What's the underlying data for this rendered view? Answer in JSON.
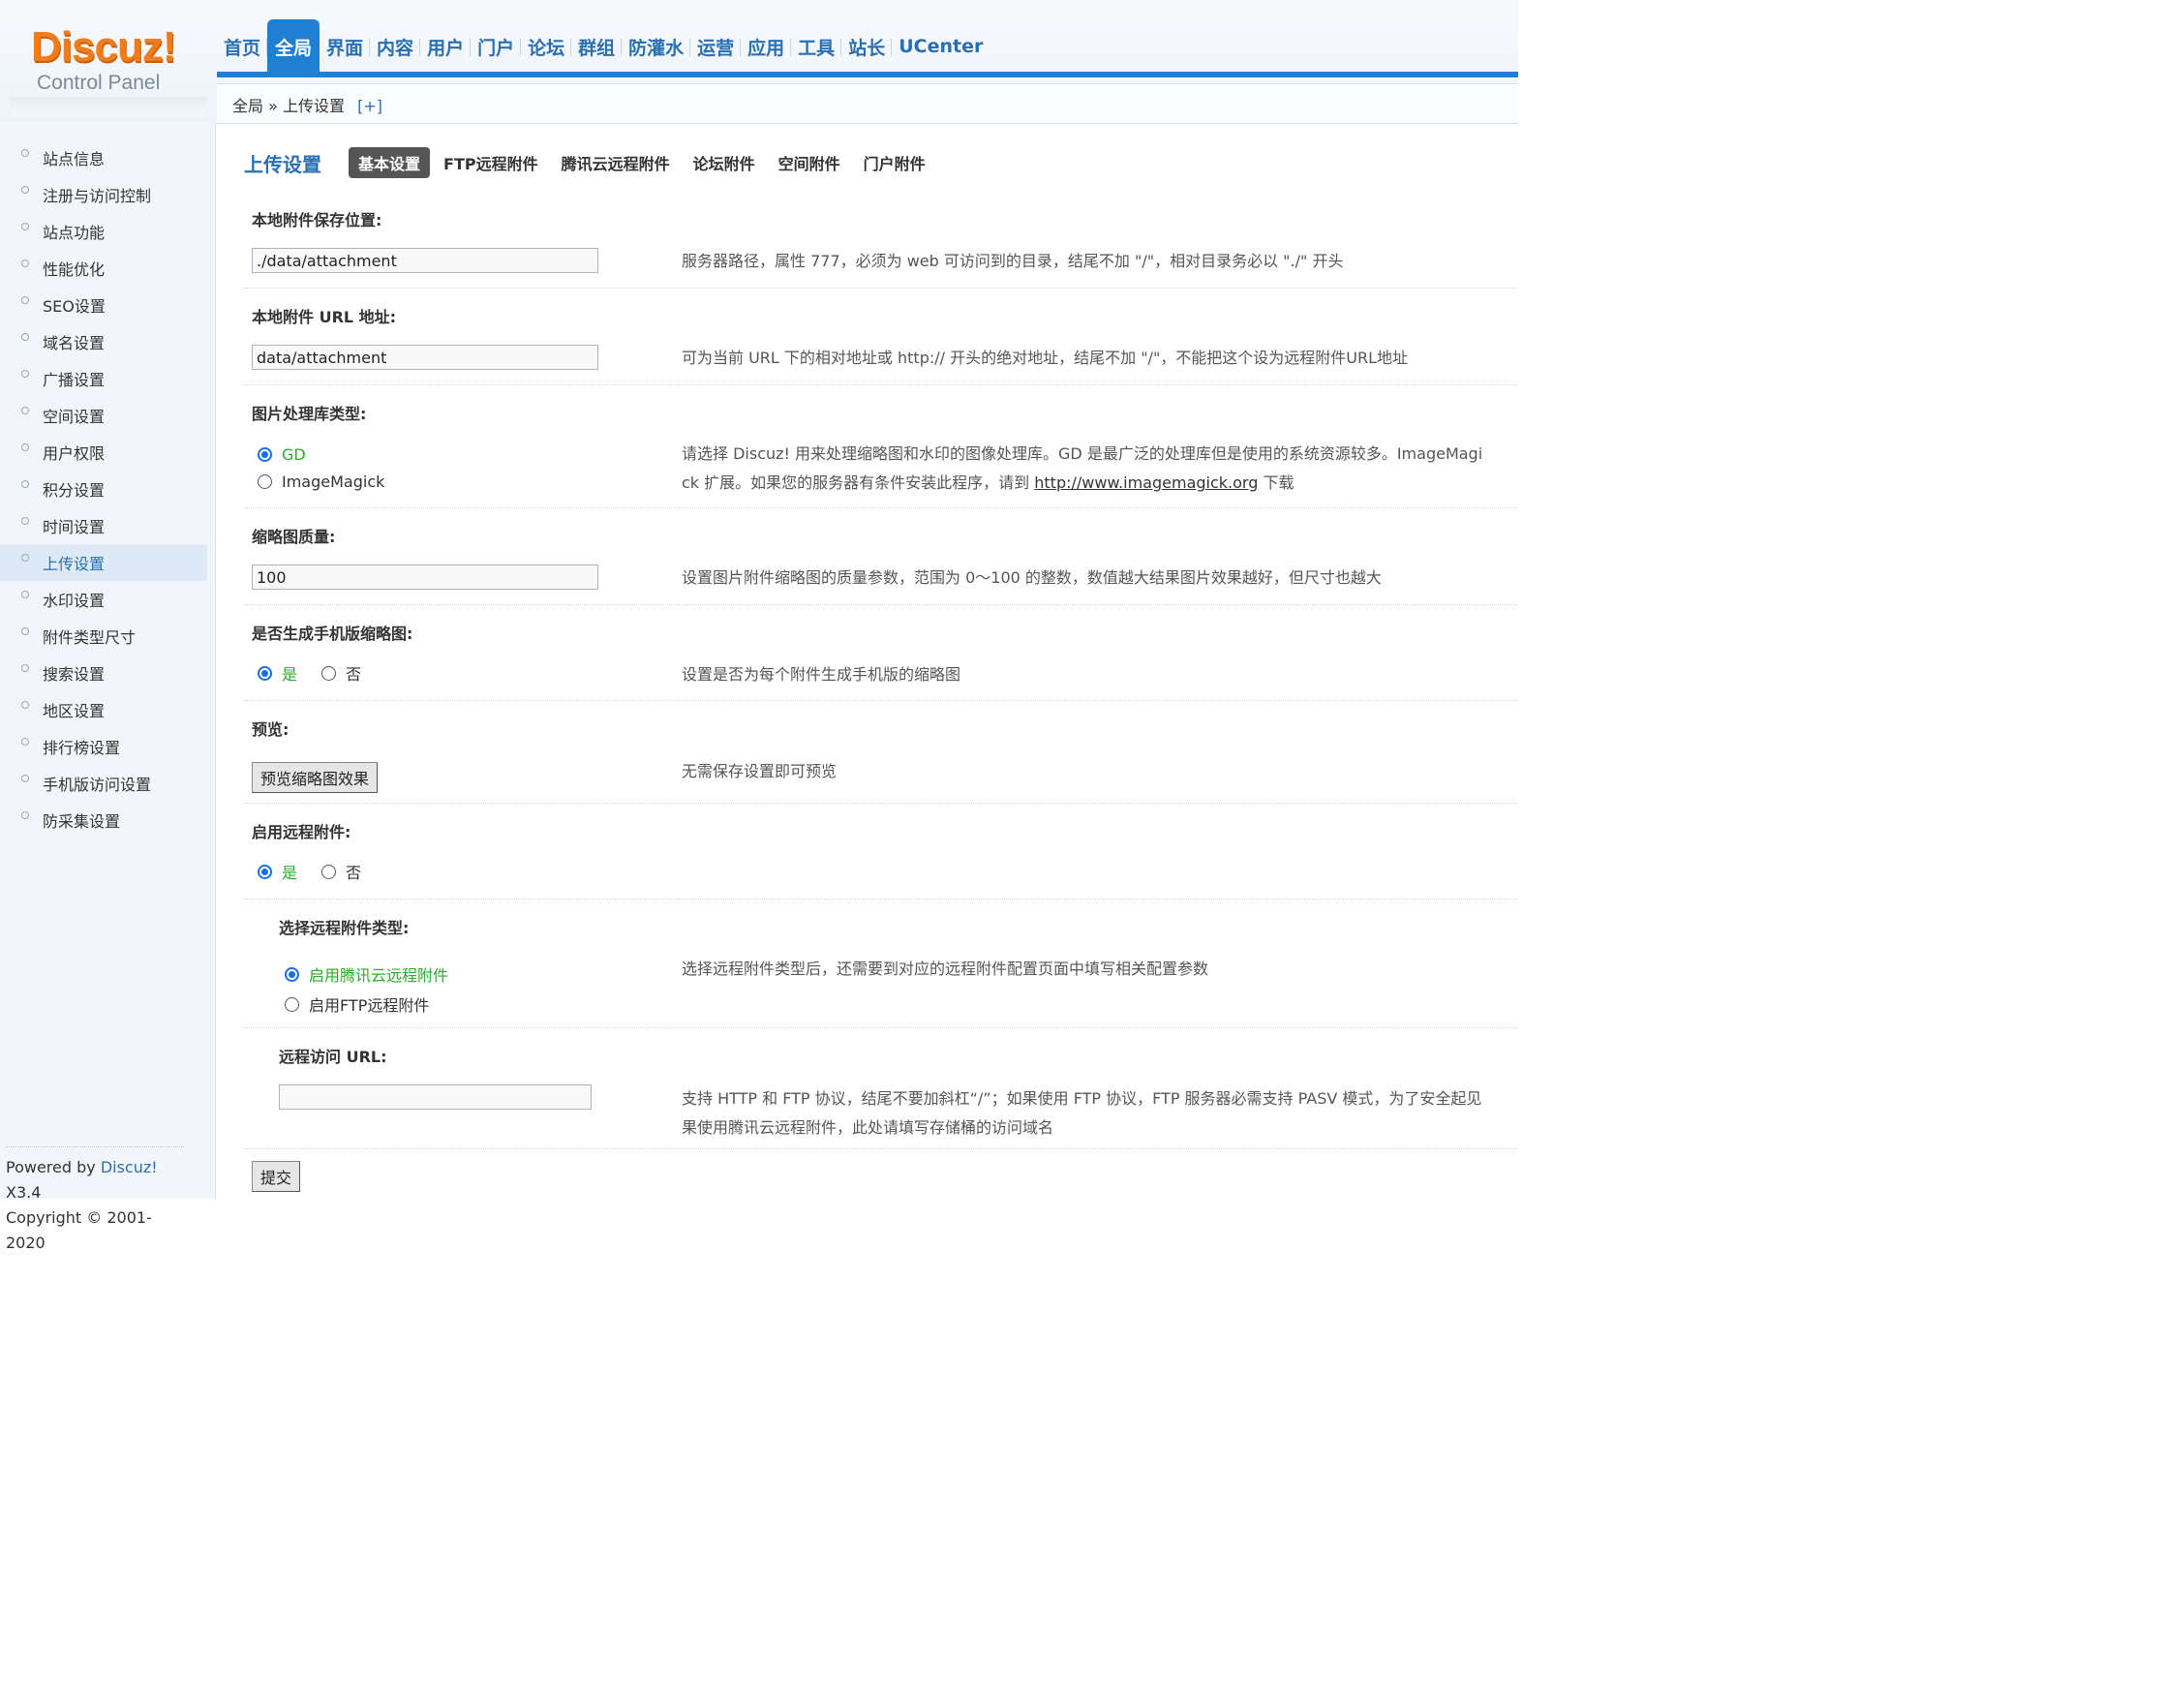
{
  "logo": {
    "title": "Discuz!",
    "subtitle": "Control Panel"
  },
  "nav": {
    "items": [
      "首页",
      "全局",
      "界面",
      "内容",
      "用户",
      "门户",
      "论坛",
      "群组",
      "防灌水",
      "运营",
      "应用",
      "工具",
      "站长",
      "UCenter"
    ],
    "active_index": 1
  },
  "breadcrumb": {
    "section": "全局",
    "separator": "»",
    "page": "上传设置",
    "toggle": "[+]"
  },
  "sidebar": {
    "items": [
      "站点信息",
      "注册与访问控制",
      "站点功能",
      "性能优化",
      "SEO设置",
      "域名设置",
      "广播设置",
      "空间设置",
      "用户权限",
      "积分设置",
      "时间设置",
      "上传设置",
      "水印设置",
      "附件类型尺寸",
      "搜索设置",
      "地区设置",
      "排行榜设置",
      "手机版访问设置",
      "防采集设置"
    ],
    "active_index": 11,
    "footer_prefix": "Powered by ",
    "footer_brand": "Discuz!",
    "footer_version": " X3.4",
    "footer_copyright": "Copyright © 2001-2020"
  },
  "page": {
    "title": "上传设置",
    "tabs": [
      "基本设置",
      "FTP远程附件",
      "腾讯云远程附件",
      "论坛附件",
      "空间附件",
      "门户附件"
    ],
    "active_tab": 0
  },
  "settings": {
    "local_path": {
      "label": "本地附件保存位置:",
      "value": "./data/attachment",
      "tip": "服务器路径，属性 777，必须为 web 可访问到的目录，结尾不加 \"/\"，相对目录务必以 \"./\" 开头"
    },
    "local_url": {
      "label": "本地附件 URL 地址:",
      "value": "data/attachment",
      "tip": "可为当前 URL 下的相对地址或 http:// 开头的绝对地址，结尾不加 \"/\"，不能把这个设为远程附件URL地址"
    },
    "image_lib": {
      "label": "图片处理库类型:",
      "options": [
        "GD",
        "ImageMagick"
      ],
      "selected": "GD",
      "tip_line1": "请选择 Discuz! 用来处理缩略图和水印的图像处理库。GD 是最广泛的处理库但是使用的系统资源较多。ImageMagi",
      "tip_line2_prefix": "ck 扩展。如果您的服务器有条件安装此程序，请到 ",
      "tip_link": "http://www.imagemagick.org",
      "tip_line2_suffix": " 下载"
    },
    "thumb_quality": {
      "label": "缩略图质量:",
      "value": "100",
      "tip": "设置图片附件缩略图的质量参数，范围为 0～100 的整数，数值越大结果图片效果越好，但尺寸也越大"
    },
    "mobile_thumb": {
      "label": "是否生成手机版缩略图:",
      "yes": "是",
      "no": "否",
      "selected": "是",
      "tip": "设置是否为每个附件生成手机版的缩略图"
    },
    "preview": {
      "label": "预览:",
      "button": "预览缩略图效果",
      "tip": "无需保存设置即可预览"
    },
    "remote_enable": {
      "label": "启用远程附件:",
      "yes": "是",
      "no": "否",
      "selected": "是"
    },
    "remote_type": {
      "label": "选择远程附件类型:",
      "options": [
        "启用腾讯云远程附件",
        "启用FTP远程附件"
      ],
      "selected": "启用腾讯云远程附件",
      "tip": "选择远程附件类型后，还需要到对应的远程附件配置页面中填写相关配置参数"
    },
    "remote_url": {
      "label": "远程访问 URL:",
      "value": "",
      "tip_line1": "支持 HTTP 和 FTP 协议，结尾不要加斜杠“/”；如果使用 FTP 协议，FTP 服务器必需支持 PASV 模式，为了安全起见",
      "tip_line2": "果使用腾讯云远程附件，此处请填写存储桶的访问域名"
    },
    "submit": "提交"
  },
  "colors": {
    "brand": "#f07c1b",
    "accent": "#1f7fd0",
    "link": "#2a6fb0",
    "radio_on": "#2eaa2e"
  }
}
